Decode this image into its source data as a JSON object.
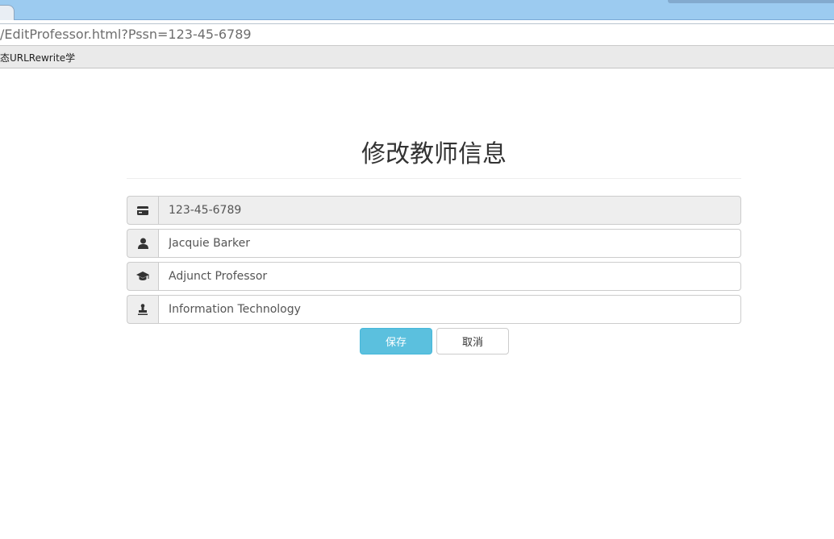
{
  "browser": {
    "address": "/EditProfessor.html?Pssn=123-45-6789",
    "bookmark": "态URLRewrite学"
  },
  "page": {
    "title": "修改教师信息"
  },
  "form": {
    "ssn": {
      "value": "123-45-6789",
      "icon": "id-card-icon"
    },
    "name": {
      "value": "Jacquie Barker",
      "icon": "user-icon"
    },
    "title": {
      "value": "Adjunct Professor",
      "icon": "graduation-cap-icon"
    },
    "department": {
      "value": "Information Technology",
      "icon": "stamp-icon"
    }
  },
  "buttons": {
    "save": "保存",
    "cancel": "取消"
  },
  "colors": {
    "save_button": "#5bc0de",
    "addon_bg": "#eeeeee",
    "chrome_top": "#9ccbf0"
  }
}
